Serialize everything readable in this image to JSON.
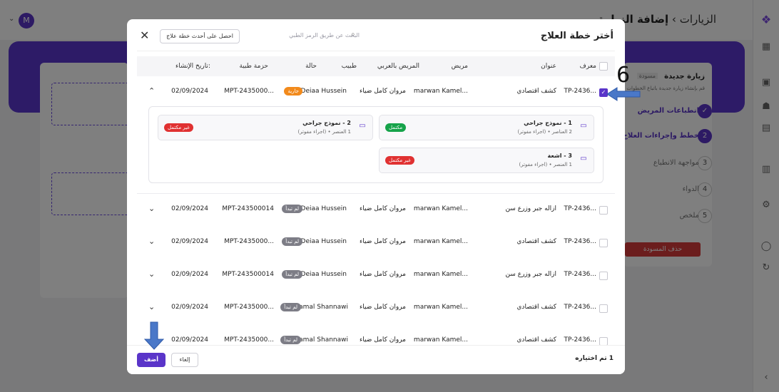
{
  "app": {
    "breadcrumb_parent": "الزيارات",
    "breadcrumb_sep": "›",
    "breadcrumb_current": "إضافة الزيارة",
    "avatar_initial": "M",
    "visit_title": "زيارة جديدة",
    "visit_status": "مسودة",
    "visit_desc": "قم بإنشاء زيارة جديدة باتباع الخطوات",
    "steps": [
      {
        "num": "✓",
        "label": "انطباعات المريض"
      },
      {
        "num": "2",
        "label": "خطط وإجراءات العلاج"
      },
      {
        "num": "3",
        "label": "مواجهة الانطباع"
      },
      {
        "num": "4",
        "label": "الدواء"
      },
      {
        "num": "5",
        "label": "ملخص"
      }
    ],
    "delete_draft": "حذف المسودة",
    "colors": {
      "accent": "#5a35c9",
      "danger": "#d63b3b"
    }
  },
  "modal": {
    "title": "أختر خطة العلاج",
    "search_placeholder": "البحث عن طريق الرمز الطبي",
    "latest_plan_button": "احصل على أحدث خطة علاج",
    "columns": {
      "id": "معرف",
      "title": "عنوان",
      "patient": "مريض",
      "patient_ar": "المريض بالعربي",
      "doctor": "طبيب",
      "status": "حالة",
      "package": "حزمة طبية",
      "created": "تاريخ الإنشاء:"
    },
    "rows": [
      {
        "id": "TP-2436...",
        "title": "كشف اقتصادي",
        "patient": "marwan Kamel...",
        "patient_ar": "مروان كامل ضياء",
        "doctor": "Deiaa Hussein",
        "status": "جارية",
        "package": "MPT-2435000...",
        "created": "02/09/2024",
        "checked": true,
        "expanded": true
      },
      {
        "id": "TP-2436...",
        "title": "ازاله جبر وزرع سن",
        "patient": "marwan Kamel...",
        "patient_ar": "مروان كامل ضياء",
        "doctor": "Deiaa Hussein",
        "status": "لم تبدأ",
        "package": "MPT-243500014",
        "created": "02/09/2024",
        "checked": false
      },
      {
        "id": "TP-2436...",
        "title": "كشف اقتصادي",
        "patient": "marwan Kamel...",
        "patient_ar": "مروان كامل ضياء",
        "doctor": "Deiaa Hussein",
        "status": "لم تبدأ",
        "package": "MPT-2435000...",
        "created": "02/09/2024",
        "checked": false
      },
      {
        "id": "TP-2436...",
        "title": "ازاله جبر وزرع سن",
        "patient": "marwan Kamel...",
        "patient_ar": "مروان كامل ضياء",
        "doctor": "Deiaa Hussein",
        "status": "لم تبدأ",
        "package": "MPT-243500014",
        "created": "02/09/2024",
        "checked": false
      },
      {
        "id": "TP-2436...",
        "title": "كشف اقتصادي",
        "patient": "marwan Kamel...",
        "patient_ar": "مروان كامل ضياء",
        "doctor": "Kamal Shannawi",
        "status": "لم تبدأ",
        "package": "MPT-2435000...",
        "created": "02/09/2024",
        "checked": false
      },
      {
        "id": "TP-2436...",
        "title": "كشف اقتصادي",
        "patient": "marwan Kamel...",
        "patient_ar": "مروان كامل ضياء",
        "doctor": "Kamal Shannawi",
        "status": "لم تبدأ",
        "package": "MPT-2435000...",
        "created": "02/09/2024",
        "checked": false
      }
    ],
    "plans": [
      {
        "title": "1 - نموذج جراحي",
        "sub": "2 العناصر • (اجراء مفوتر)",
        "status": "مكتمل"
      },
      {
        "title": "2 - نموذج جراحي",
        "sub": "1 العنصر • (اجراء مفوتر)",
        "status": "غير مكتمل"
      },
      {
        "title": "3 - اشعة",
        "sub": "1 العنصر • (اجراء مفوتر)",
        "status": "غير مكتمل"
      }
    ],
    "selected_count": "1 تم اختياره",
    "cancel_button": "إلغاء",
    "add_button": "أضف"
  },
  "annotation": {
    "step_number": "6"
  }
}
